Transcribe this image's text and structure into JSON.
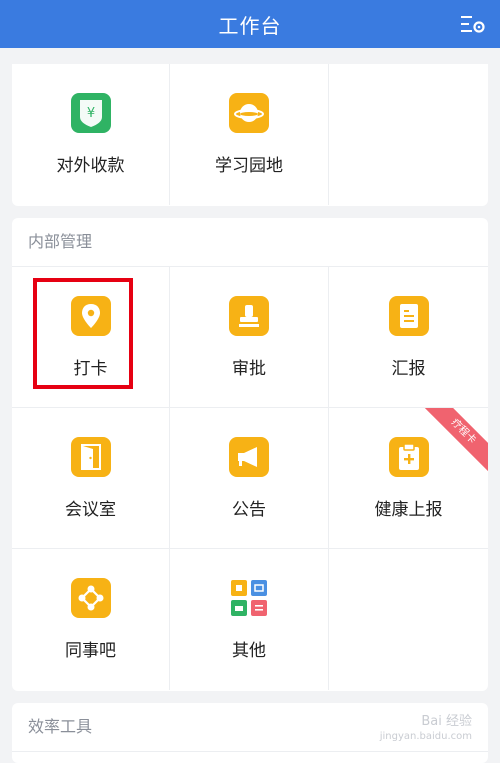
{
  "header": {
    "title": "工作台"
  },
  "top_card": {
    "items": [
      {
        "label": "对外收款",
        "icon": "yuan-shield-icon",
        "color": "#2fb364"
      },
      {
        "label": "学习园地",
        "icon": "planet-icon",
        "color": "#f7b215"
      }
    ]
  },
  "internal": {
    "title": "内部管理",
    "items": [
      {
        "label": "打卡",
        "icon": "location-pin-icon"
      },
      {
        "label": "审批",
        "icon": "stamp-icon"
      },
      {
        "label": "汇报",
        "icon": "document-icon"
      },
      {
        "label": "会议室",
        "icon": "door-icon"
      },
      {
        "label": "公告",
        "icon": "megaphone-icon"
      },
      {
        "label": "健康上报",
        "icon": "clipboard-plus-icon",
        "badge": "疗程卡"
      },
      {
        "label": "同事吧",
        "icon": "network-icon"
      },
      {
        "label": "其他",
        "icon": "apps-grid-icon"
      }
    ]
  },
  "efficiency": {
    "title": "效率工具"
  },
  "watermark": {
    "line1": "Bai 经验",
    "line2": "jingyan.baidu.com"
  },
  "colors": {
    "header": "#3a7be0",
    "icon_orange": "#f7b215",
    "highlight": "#e60012"
  }
}
